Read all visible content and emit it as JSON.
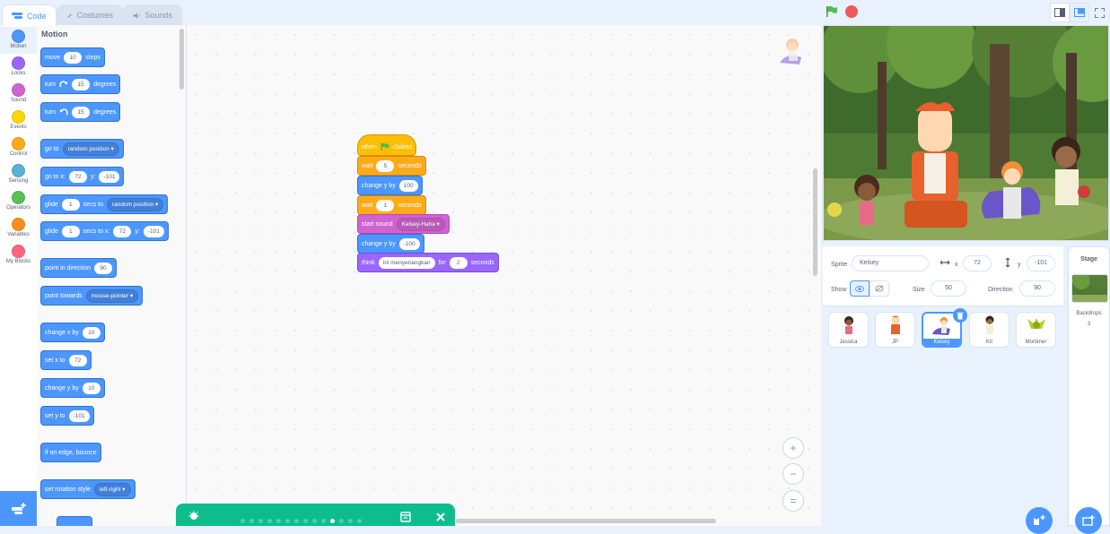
{
  "tabs": [
    {
      "label": "Code",
      "icon": "code-icon",
      "active": true
    },
    {
      "label": "Costumes",
      "icon": "brush-icon",
      "active": false
    },
    {
      "label": "Sounds",
      "icon": "speaker-icon",
      "active": false
    }
  ],
  "categories": [
    {
      "label": "Motion",
      "color": "#4c97ff"
    },
    {
      "label": "Looks",
      "color": "#9966ff"
    },
    {
      "label": "Sound",
      "color": "#cf63cf"
    },
    {
      "label": "Events",
      "color": "#ffd500"
    },
    {
      "label": "Control",
      "color": "#ffab19"
    },
    {
      "label": "Sensing",
      "color": "#5cb1d6"
    },
    {
      "label": "Operators",
      "color": "#59c059"
    },
    {
      "label": "Variables",
      "color": "#ff8c1a"
    },
    {
      "label": "My Blocks",
      "color": "#ff6680"
    }
  ],
  "palette": {
    "title": "Motion",
    "move": {
      "a": "move",
      "v": "10",
      "b": "steps"
    },
    "turn_right": {
      "a": "turn",
      "v": "15",
      "b": "degrees"
    },
    "turn_left": {
      "a": "turn",
      "v": "15",
      "b": "degrees"
    },
    "goto": {
      "a": "go to",
      "dd": "random position"
    },
    "goto_xy": {
      "a": "go to x:",
      "x": "72",
      "b": "y:",
      "y": "-101"
    },
    "glide": {
      "a": "glide",
      "v": "1",
      "b": "secs to",
      "dd": "random position"
    },
    "glide_xy": {
      "a": "glide",
      "v": "1",
      "b": "secs to x:",
      "x": "72",
      "c": "y:",
      "y": "-101"
    },
    "point_dir": {
      "a": "point in direction",
      "v": "90"
    },
    "point_towards": {
      "a": "point towards",
      "dd": "mouse-pointer"
    },
    "change_x": {
      "a": "change x by",
      "v": "10"
    },
    "set_x": {
      "a": "set x to",
      "v": "72"
    },
    "change_y": {
      "a": "change y by",
      "v": "10"
    },
    "set_y": {
      "a": "set y to",
      "v": "-101"
    },
    "bounce": {
      "a": "if on edge, bounce"
    },
    "rot_style": {
      "a": "set rotation style",
      "dd": "left-right"
    }
  },
  "script": {
    "hat": {
      "a": "when",
      "b": "clicked"
    },
    "wait1": {
      "a": "wait",
      "v": "5",
      "b": "seconds"
    },
    "change_y1": {
      "a": "change y by",
      "v": "100"
    },
    "wait2": {
      "a": "wait",
      "v": "1",
      "b": "seconds"
    },
    "sound": {
      "a": "start sound",
      "dd": "Kelsey-Haha"
    },
    "change_y2": {
      "a": "change y by",
      "v": "-100"
    },
    "think": {
      "a": "think",
      "v": "ini menyenangkan",
      "b": "for",
      "t": "2",
      "c": "seconds"
    }
  },
  "zoom": {
    "in": "+",
    "out": "−",
    "reset": "="
  },
  "sprite_info": {
    "sprite_label": "Sprite",
    "sprite_name": "Kelsey",
    "x_label": "x",
    "x": "72",
    "y_label": "y",
    "y": "-101",
    "show_label": "Show",
    "size_label": "Size",
    "size": "50",
    "direction_label": "Direction",
    "direction": "90"
  },
  "sprites": [
    {
      "name": "Jessica",
      "selected": false
    },
    {
      "name": "JP",
      "selected": false
    },
    {
      "name": "Kelsey",
      "selected": true
    },
    {
      "name": "Kit",
      "selected": false
    },
    {
      "name": "Mortimer",
      "selected": false
    }
  ],
  "stage_panel": {
    "title": "Stage",
    "backdrops_label": "Backdrops",
    "backdrops_count": "3"
  },
  "colors": {
    "accent": "#4c97ff",
    "tutorial": "#0fbd8c",
    "stop": "#ec5959",
    "flag": "#4cbf56"
  }
}
